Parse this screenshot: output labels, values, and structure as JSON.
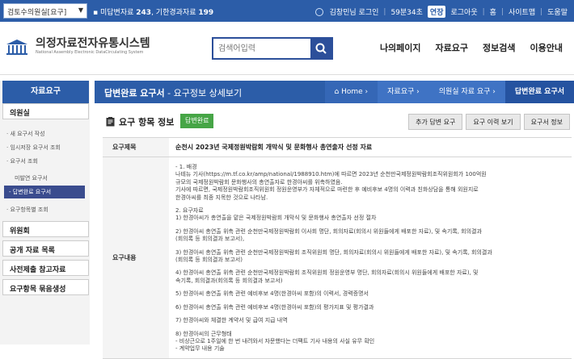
{
  "topbar": {
    "select_value": "검토수의원실[요구]",
    "unreg_label": "미답변자료",
    "unreg_count": "243",
    "dead_label": "기한경과자료",
    "dead_count": "199",
    "user": "김창민님 로그인",
    "timer": "59분34초",
    "extend": "연장",
    "links": [
      "로그아웃",
      "홈",
      "사이트맵",
      "도움말"
    ]
  },
  "logo": {
    "title": "의정자료전자유통시스템",
    "subtitle": "National Assembly Electronic DataCirculating System"
  },
  "search": {
    "placeholder": "검색어입력"
  },
  "nav": [
    "나의페이지",
    "자료요구",
    "정보검색",
    "이용안내"
  ],
  "sidebar": {
    "title": "자료요구",
    "cat1": "의원실",
    "items": [
      "새 요구서 작성",
      "임시저장 요구서 조회",
      "요구서 조회"
    ],
    "subitems": [
      "미발연 요구서"
    ],
    "active": "답변완료 요구서",
    "item_last": "요구항목별 조회",
    "cat2": "위원회",
    "cat3": "공개 자료 목록",
    "cat4": "사전제출 참고자료",
    "cat5": "요구항목 묶음생성"
  },
  "titlebar": {
    "title": "답변완료 요구서",
    "subtitle": " - 요구정보 상세보기",
    "crumbs": [
      "Home",
      "자료요구",
      "의원실 자료 요구",
      "답변완료 요구서"
    ]
  },
  "content": {
    "section_title": "요구 항목 정보",
    "status_badge": "답변완료",
    "actions": [
      "추가 답변 요구",
      "요구 이력 보기",
      "요구서 정보"
    ],
    "subject_label": "요구제목",
    "subject": "순천시 2023년 국제정원박람회 개막식 및 문화행사 총연출자 선정 자료",
    "body_label": "요구내용",
    "body_lines": [
      "- 1. 배경",
      "나테뉴 기사(https://m.tf.co.kr/amp/national/1988910.htm)에 따르면 2023년 순천만국제정원박람회조직위원회가 100억원",
      "규모의 국제정원박람회 문화행사의 총연출자로 한경아씨를 위촉하였음.",
      "기사에 따르면, 국제정원박람회조직위원회 정원운영부가 자체적으로 마련한 후 예비후보 4명의 이력과 친화상담을 통해 외원지로",
      "한경아씨를 최종 지목한 것으로 나타남.",
      "",
      "2. 요구자료",
      "1) 한경아씨가 총연출을 맡은 국제정원박람회 개막식 및 문화행사 총연출자 선정 절차",
      "",
      "2) 한경아씨 총연출 위촉 관련 순천만국제정원박람회 이사회 명단, 회의자료(회의시 위원들에게 배포한 자료), 및 속기록, 회의결과",
      "(회의록 등 회의결과 보고서),",
      "",
      "3) 한경아씨 총연출 위촉 관련 순천만국제정원박람회 조직위원회 명단, 회의자료(회의시 위원들에게 배포한 자료), 및 속기록, 회의결과",
      "(회의록 등 회의결과 보고서)",
      "",
      "4) 한경아씨 총연출 위촉 관련 순천만국제정원박람회 조직위원회 정원운영부 명단, 회의자료(회의시 위원들에게 배포한 자료), 및",
      "속기록, 회의결과(회의록 등 회의결과 보고서)",
      "",
      "5) 한경아씨 총연출 위촉 관련 예비후보 4명(한경아씨 포함)의 이력서, 경력증명서",
      "",
      "6) 한경아씨 총연출 위촉 관련 예비후보 4명(한경아씨 포함)의 평가지표 및 평가결과",
      "",
      "7) 한경아씨와 체결한 계약서 및 급여 지급 내역",
      "",
      "8) 한경아씨의 근무형태",
      "- 비상근으로 1주일에 한 번 내려와서 자문했다는 더팩트 기사 내용의 사실 유무 확인",
      "- 계약업무 내용 기술"
    ]
  }
}
